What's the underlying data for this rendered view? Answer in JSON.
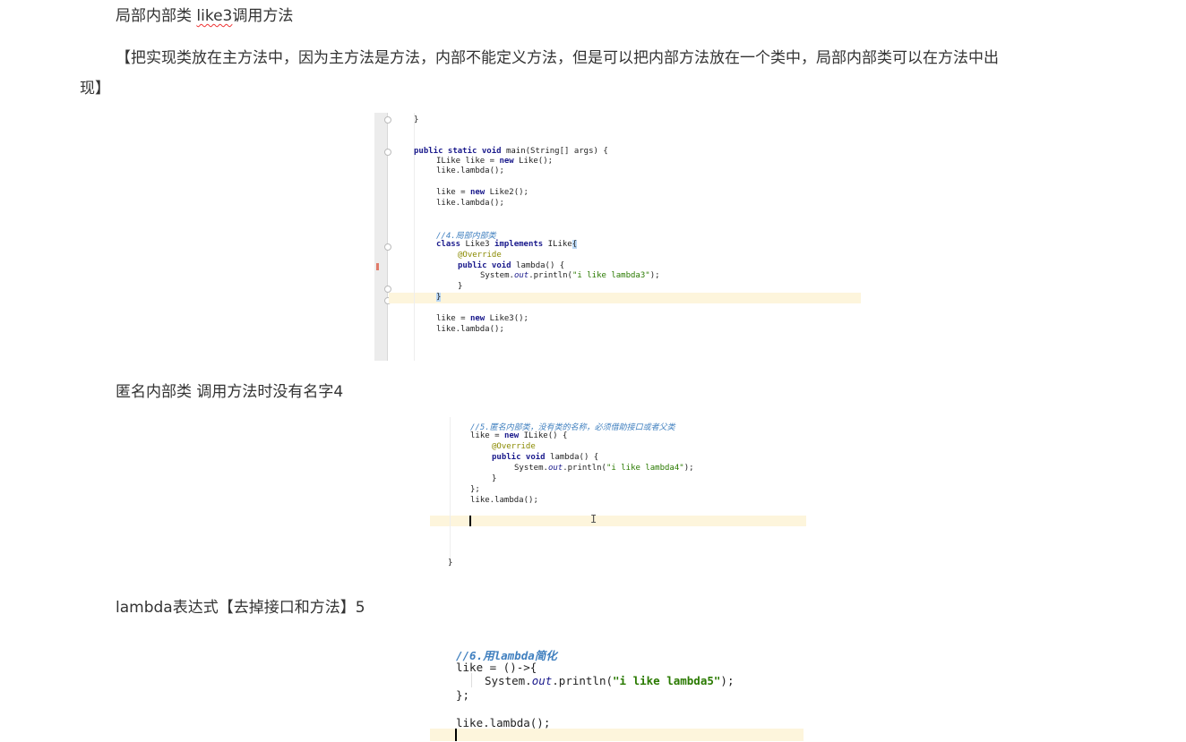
{
  "p1": {
    "prefix": "局部内部类 ",
    "highlight": "like3",
    "suffix": "调用方法"
  },
  "p2": {
    "line1": "【把实现类放在主方法中，因为主方法是方法，内部不能定义方法，但是可以把内部方法放在一个类中，局部内部类可以在方法中出",
    "line2": "现】"
  },
  "img1": {
    "l1": "}",
    "l2a": "public static void",
    "l2b": " main(String[] args) {",
    "l3a": "ILike like = ",
    "l3b": "new",
    "l3c": " Like();",
    "l4": "like.lambda();",
    "l5a": "like = ",
    "l5b": "new",
    "l5c": " Like2();",
    "l6": "like.lambda();",
    "l7": "//4.局部内部类",
    "l8a": "class",
    "l8b": " Like3 ",
    "l8c": "implements",
    "l8d": " ILike",
    "l8e": "{",
    "l9": "@Override",
    "l10a": "public void",
    "l10b": " lambda() {",
    "l11a": "System.",
    "l11b": "out",
    "l11c": ".println(",
    "l11d": "\"i like lambda3\"",
    "l11e": ");",
    "l12": "}",
    "l13": "}",
    "l14a": "like = ",
    "l14b": "new",
    "l14c": " Like3();",
    "l15": "like.lambda();"
  },
  "p3": "匿名内部类  调用方法时没有名字4",
  "img2": {
    "l1": "//5.匿名内部类，没有类的名称，必须借助接口或者父类",
    "l2a": "like = ",
    "l2b": "new",
    "l2c": " ILike() {",
    "l3": "@Override",
    "l4a": "public void",
    "l4b": " lambda() {",
    "l5a": "System.",
    "l5b": "out",
    "l5c": ".println(",
    "l5d": "\"i like lambda4\"",
    "l5e": ");",
    "l6": "}",
    "l7": "};",
    "l8": "like.lambda();",
    "l9": "}",
    "cursor_glyph": "I"
  },
  "p4": "lambda表达式【去掉接口和方法】5",
  "img3": {
    "l1": "//6.用lambda简化",
    "l2": "like = ()->{",
    "l3a": "System.",
    "l3b": "out",
    "l3c": ".println(",
    "l3d": "\"i like lambda5\"",
    "l3e": ");",
    "l4": "};",
    "l5": "like.lambda();"
  },
  "colors": {
    "text": "#333333",
    "keyword": "#1a1a8c",
    "comment": "#3f7fbf",
    "string": "#2a7a00",
    "current_line": "#fdf5dc"
  }
}
